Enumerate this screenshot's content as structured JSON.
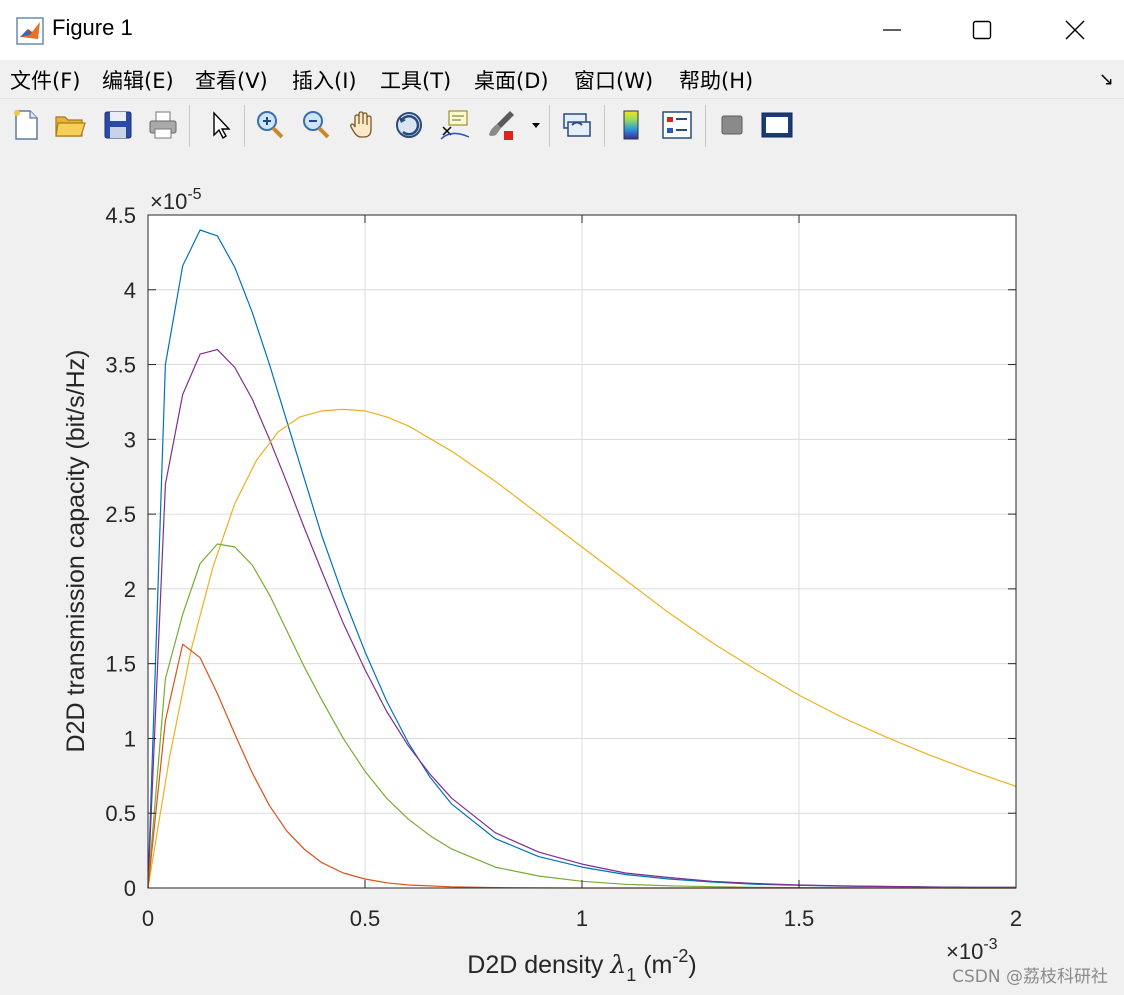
{
  "window": {
    "title": "Figure 1"
  },
  "menu": {
    "items": [
      {
        "label": "文件(F)",
        "key": "F"
      },
      {
        "label": "编辑(E)",
        "key": "E"
      },
      {
        "label": "查看(V)",
        "key": "V"
      },
      {
        "label": "插入(I)",
        "key": "I"
      },
      {
        "label": "工具(T)",
        "key": "T"
      },
      {
        "label": "桌面(D)",
        "key": "D"
      },
      {
        "label": "窗口(W)",
        "key": "W"
      },
      {
        "label": "帮助(H)",
        "key": "H"
      }
    ]
  },
  "toolbar": {
    "icons": [
      "new-figure-icon",
      "open-file-icon",
      "save-icon",
      "print-icon",
      "select-arrow-icon",
      "zoom-in-icon",
      "zoom-out-icon",
      "pan-hand-icon",
      "rotate-3d-icon",
      "data-cursor-icon",
      "brush-icon",
      "link-plot-icon",
      "colorbar-icon",
      "legend-icon",
      "hide-plot-tools-icon",
      "show-plot-tools-icon"
    ]
  },
  "watermark": "CSDN @荔枝科研社",
  "chart_data": {
    "type": "line",
    "title": "",
    "xlabel": "D2D density λ1 (m-2)",
    "xlabel_parts": {
      "main": "D2D density ",
      "symbol": "λ",
      "sub": "1",
      "unit_open": " (m",
      "sup": "-2",
      "unit_close": ")"
    },
    "ylabel": "D2D transmission capacity (bit/s/Hz)",
    "x_exponent": {
      "base": "×10",
      "power": "-3"
    },
    "y_exponent": {
      "base": "×10",
      "power": "-5"
    },
    "xlim": [
      0,
      0.002
    ],
    "ylim": [
      0,
      4.5e-05
    ],
    "x_ticks": [
      0,
      0.0005,
      0.001,
      0.0015,
      0.002
    ],
    "x_tick_labels": [
      "0",
      "0.5",
      "1",
      "1.5",
      "2"
    ],
    "y_ticks": [
      0,
      5e-06,
      1e-05,
      1.5e-05,
      2e-05,
      2.5e-05,
      3e-05,
      3.5e-05,
      4e-05,
      4.5e-05
    ],
    "y_tick_labels": [
      "0",
      "0.5",
      "1",
      "1.5",
      "2",
      "2.5",
      "3",
      "3.5",
      "4",
      "4.5"
    ],
    "grid": true,
    "x_unit_scale": 0.001,
    "y_unit_scale": 1e-05,
    "series": [
      {
        "color": "#0072bd",
        "x": [
          0,
          0.04,
          0.08,
          0.12,
          0.16,
          0.2,
          0.24,
          0.28,
          0.32,
          0.36,
          0.4,
          0.45,
          0.5,
          0.55,
          0.6,
          0.65,
          0.7,
          0.8,
          0.9,
          1.0,
          1.1,
          1.2,
          1.3,
          1.4,
          1.5,
          1.6,
          1.7,
          1.8,
          1.9,
          2.0
        ],
        "y": [
          0,
          3.5,
          4.16,
          4.4,
          4.36,
          4.15,
          3.85,
          3.5,
          3.12,
          2.74,
          2.36,
          1.95,
          1.58,
          1.25,
          0.97,
          0.74,
          0.56,
          0.33,
          0.21,
          0.14,
          0.09,
          0.06,
          0.04,
          0.025,
          0.018,
          0.013,
          0.01,
          0.007,
          0.005,
          0.004
        ]
      },
      {
        "color": "#7e2f8e",
        "x": [
          0,
          0.04,
          0.08,
          0.12,
          0.16,
          0.2,
          0.24,
          0.28,
          0.32,
          0.36,
          0.4,
          0.45,
          0.5,
          0.55,
          0.6,
          0.65,
          0.7,
          0.8,
          0.9,
          1.0,
          1.1,
          1.2,
          1.3,
          1.4,
          1.5,
          1.6,
          1.7,
          1.8,
          1.9,
          2.0
        ],
        "y": [
          0,
          2.7,
          3.3,
          3.57,
          3.6,
          3.48,
          3.27,
          3.0,
          2.71,
          2.41,
          2.12,
          1.77,
          1.46,
          1.18,
          0.95,
          0.76,
          0.6,
          0.37,
          0.24,
          0.16,
          0.1,
          0.07,
          0.045,
          0.03,
          0.02,
          0.014,
          0.01,
          0.007,
          0.005,
          0.004
        ]
      },
      {
        "color": "#edb120",
        "x": [
          0,
          0.05,
          0.1,
          0.15,
          0.2,
          0.25,
          0.3,
          0.35,
          0.4,
          0.45,
          0.5,
          0.55,
          0.6,
          0.7,
          0.8,
          0.9,
          1.0,
          1.1,
          1.2,
          1.3,
          1.4,
          1.5,
          1.6,
          1.7,
          1.8,
          1.9,
          2.0
        ],
        "y": [
          0,
          0.88,
          1.6,
          2.15,
          2.57,
          2.86,
          3.05,
          3.15,
          3.19,
          3.2,
          3.19,
          3.15,
          3.09,
          2.92,
          2.72,
          2.5,
          2.28,
          2.06,
          1.84,
          1.64,
          1.46,
          1.29,
          1.14,
          1.01,
          0.89,
          0.78,
          0.68
        ]
      },
      {
        "color": "#77ac30",
        "x": [
          0,
          0.04,
          0.08,
          0.12,
          0.16,
          0.2,
          0.24,
          0.28,
          0.32,
          0.36,
          0.4,
          0.45,
          0.5,
          0.55,
          0.6,
          0.65,
          0.7,
          0.8,
          0.9,
          1.0,
          1.1,
          1.2,
          1.3,
          1.4,
          1.5,
          1.6,
          1.7,
          1.8,
          1.9,
          2.0
        ],
        "y": [
          0,
          1.4,
          1.83,
          2.17,
          2.3,
          2.28,
          2.16,
          1.96,
          1.72,
          1.48,
          1.26,
          1.0,
          0.78,
          0.6,
          0.46,
          0.35,
          0.26,
          0.14,
          0.08,
          0.045,
          0.025,
          0.015,
          0.009,
          0.005,
          0.003,
          0.002,
          0.001,
          0.001,
          0.0,
          0.0
        ]
      },
      {
        "color": "#d95319",
        "x": [
          0,
          0.04,
          0.08,
          0.12,
          0.16,
          0.2,
          0.24,
          0.28,
          0.32,
          0.36,
          0.4,
          0.45,
          0.5,
          0.55,
          0.6,
          0.7,
          0.8,
          0.9,
          1.0,
          1.2,
          1.4,
          1.6,
          1.8,
          2.0
        ],
        "y": [
          0,
          1.12,
          1.63,
          1.54,
          1.3,
          1.03,
          0.77,
          0.55,
          0.38,
          0.26,
          0.17,
          0.1,
          0.06,
          0.035,
          0.02,
          0.008,
          0.003,
          0.001,
          0.0,
          0.0,
          0.0,
          0.0,
          0.0,
          0.0
        ]
      }
    ]
  }
}
